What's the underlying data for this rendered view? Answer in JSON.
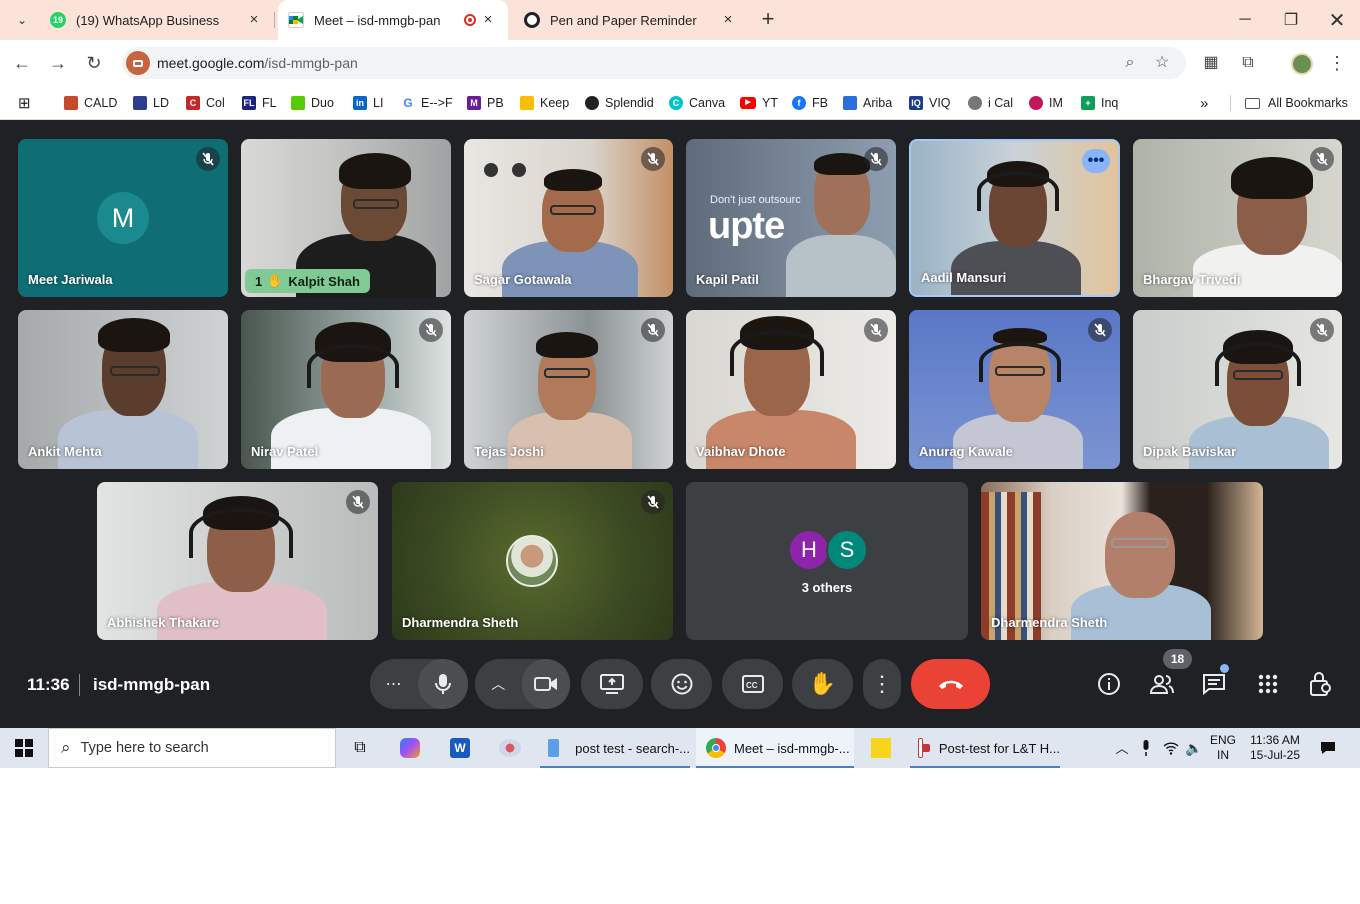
{
  "browser": {
    "tabs": [
      {
        "title": "(19) WhatsApp Business",
        "badge": "19",
        "active": false
      },
      {
        "title": "Meet – isd-mmgb-pan",
        "active": true
      },
      {
        "title": "Pen and Paper Reminder",
        "active": false
      }
    ],
    "url_domain": "meet.google.com",
    "url_path": "/isd-mmgb-pan",
    "bookmarks": [
      {
        "label": "CALD",
        "color": "#c44a2b"
      },
      {
        "label": "LD",
        "color": "#2b3f8e"
      },
      {
        "label": "Col",
        "color": "#c62828"
      },
      {
        "label": "FL",
        "color": "#1a237e"
      },
      {
        "label": "Duo",
        "color": "#58cc02"
      },
      {
        "label": "LI",
        "color": "#0a66c2"
      },
      {
        "label": "E-->F",
        "color": "#4285f4"
      },
      {
        "label": "PB",
        "color": "#6a1b9a"
      },
      {
        "label": "Keep",
        "color": "#fbbc04"
      },
      {
        "label": "Splendid",
        "color": "#222222"
      },
      {
        "label": "Canva",
        "color": "#00c4cc"
      },
      {
        "label": "YT",
        "color": "#ff0000"
      },
      {
        "label": "FB",
        "color": "#1877f2"
      },
      {
        "label": "Ariba",
        "color": "#2a6fdb"
      },
      {
        "label": "VIQ",
        "color": "#1c3d8c"
      },
      {
        "label": "i Cal",
        "color": "#777777"
      },
      {
        "label": "IM",
        "color": "#c2185b"
      },
      {
        "label": "Inq",
        "color": "#0f9d58"
      }
    ],
    "all_bookmarks": "All Bookmarks"
  },
  "meet": {
    "participants": [
      {
        "name": "Meet Jariwala",
        "muted": true,
        "avatar_letter": "M"
      },
      {
        "name": "Kalpit Shah",
        "muted": false,
        "hand_raised": true,
        "hand_count": "1"
      },
      {
        "name": "Sagar Gotawala",
        "muted": true
      },
      {
        "name": "Kapil Patil",
        "muted": true,
        "backdrop_text_top": "Don't just outsourc",
        "backdrop_text_big": "upte"
      },
      {
        "name": "Aadil Mansuri",
        "muted": false,
        "selected": true
      },
      {
        "name": "Bhargav Trivedi",
        "muted": true
      },
      {
        "name": "Ankit Mehta",
        "muted": false
      },
      {
        "name": "Nirav Patel",
        "muted": true
      },
      {
        "name": "Tejas Joshi",
        "muted": true
      },
      {
        "name": "Vaibhav Dhote",
        "muted": true
      },
      {
        "name": "Anurag Kawale",
        "muted": true
      },
      {
        "name": "Dipak Baviskar",
        "muted": true
      },
      {
        "name": "Abhishek Thakare",
        "muted": true
      },
      {
        "name": "Dharmendra Sheth",
        "muted": true
      },
      {
        "name": "3 others",
        "avatars": [
          "H",
          "S"
        ]
      },
      {
        "name": "Dharmendra Sheth",
        "muted": false
      }
    ],
    "time": "11:36",
    "meeting_code": "isd-mmgb-pan",
    "people_count": "18"
  },
  "taskbar": {
    "search_placeholder": "Type here to search",
    "apps": [
      {
        "label": "post test - search-..."
      },
      {
        "label": "Meet – isd-mmgb-..."
      },
      {
        "label": "Post-test for L&T H..."
      }
    ],
    "lang": "ENG",
    "region": "IN",
    "time": "11:36 AM",
    "date": "15-Jul-25"
  },
  "colors": {
    "meet_bg": "#202124",
    "end_call": "#ea4335",
    "tabstrip": "#fbe3d9",
    "hand_badge": "#81c995",
    "accent_blue": "#8ab4f8"
  }
}
